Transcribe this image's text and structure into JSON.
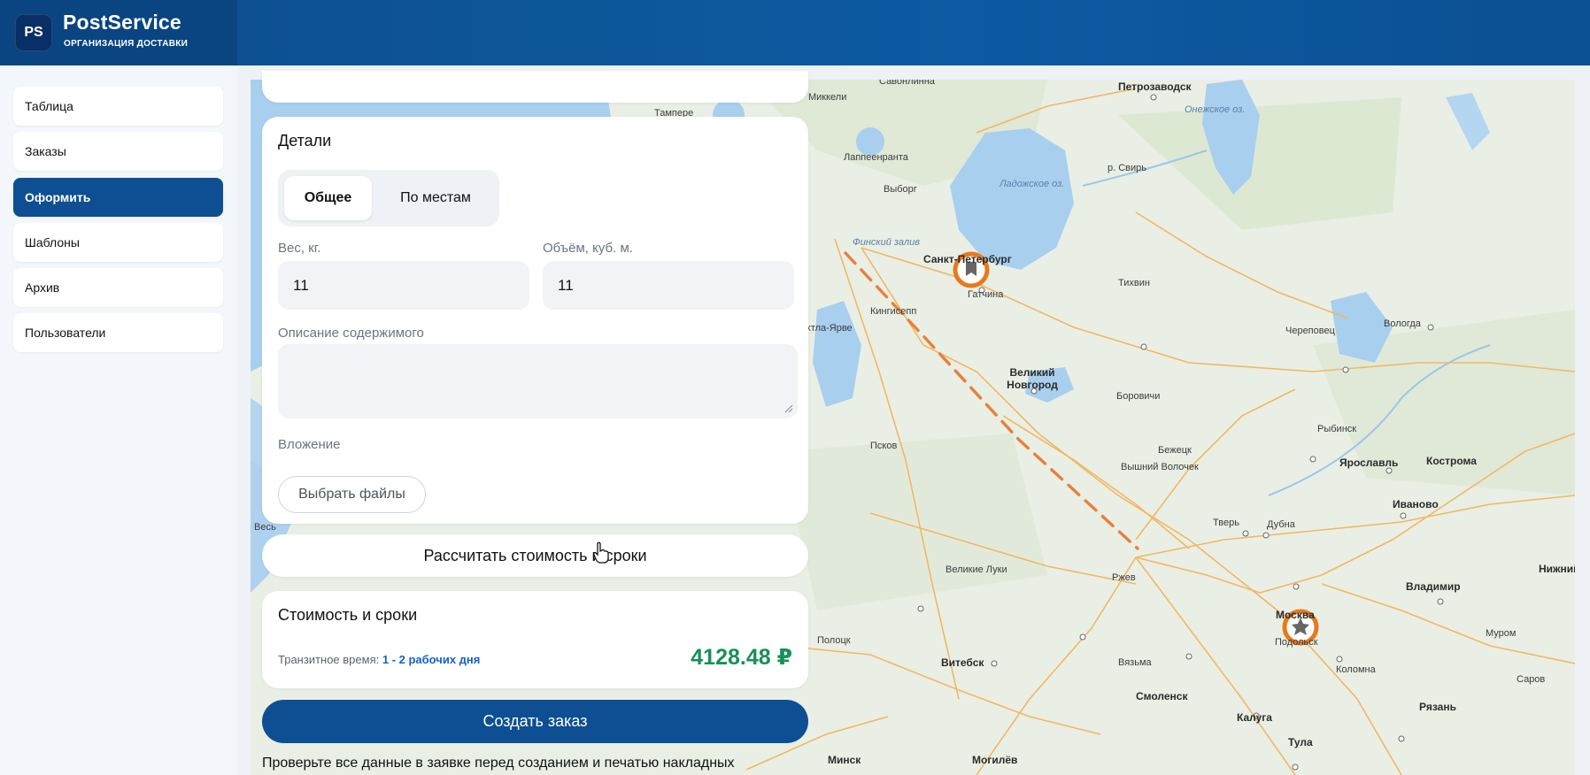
{
  "app": {
    "logo_badge": "PS",
    "name": "PostService",
    "subtitle": "ОРГАНИЗАЦИЯ ДОСТАВКИ"
  },
  "sidebar": {
    "items": [
      {
        "label": "Таблица",
        "active": false
      },
      {
        "label": "Заказы",
        "active": false
      },
      {
        "label": "Оформить",
        "active": true
      },
      {
        "label": "Шаблоны",
        "active": false
      },
      {
        "label": "Архив",
        "active": false
      },
      {
        "label": "Пользователи",
        "active": false
      }
    ]
  },
  "details": {
    "title": "Детали",
    "tabs": {
      "general": "Общее",
      "by_places": "По местам"
    },
    "weight": {
      "label": "Вес, кг.",
      "value": "11"
    },
    "volume": {
      "label": "Объём, куб. м.",
      "value": "11"
    },
    "description": {
      "label": "Описание содержимого",
      "value": ""
    },
    "attachment": {
      "label": "Вложение",
      "button": "Выбрать файлы"
    }
  },
  "actions": {
    "calculate": "Рассчитать стоимость и сроки",
    "create_order": "Создать заказ",
    "note": "Проверьте все данные в заявке перед созданием и печатью накладных"
  },
  "cost": {
    "title": "Стоимость и сроки",
    "transit_label": "Транзитное время:",
    "transit_value": "1 - 2 рабочих дня",
    "price": "4128.48 ₽"
  },
  "map": {
    "labels": {
      "petrozavodsk": "Петрозаводск",
      "onega": "Онежское оз.",
      "ladoga": "Ладожское оз.",
      "spb": "Санкт-Петербург",
      "gatchina": "Гатчина",
      "kingisepp": "Кингисепп",
      "vyborg": "Выборг",
      "gulf": "Финский залив",
      "svir": "р. Свирь",
      "tikhvin": "Тихвин",
      "cherepovets": "Череповец",
      "vologda": "Вологда",
      "novgorod": "Великий Новгород",
      "borovichi": "Боровичи",
      "rybinsk": "Рыбинск",
      "pskov": "Псков",
      "bezhetsk": "Бежецк",
      "yaroslavl": "Ярославль",
      "kostroma": "Кострома",
      "vyshny": "Вышний Волочек",
      "tver": "Тверь",
      "dubna": "Дубна",
      "ivanovo": "Иваново",
      "velikie_luki": "Великие Луки",
      "rzhev": "Ржев",
      "vladimir": "Владимир",
      "nizhny": "Нижний",
      "moscow": "Москва",
      "podolsk": "Подольск",
      "polotsk": "Полоцк",
      "vitebsk": "Витебск",
      "smolensk": "Смоленск",
      "vyazma": "Вязьма",
      "kolomna": "Коломна",
      "ryazan": "Рязань",
      "kaluga": "Калуга",
      "tula": "Тула",
      "minsk": "Минск",
      "mogilev": "Могилёв",
      "murom": "Муром",
      "sarov": "Саров",
      "mikkeli": "Миккели",
      "savonlinna": "Савонлинна",
      "lappeenranta": "Лаппеенранта",
      "tampere": "Тампере",
      "narva": "Кохтла-Ярве",
      "vesi": "Весь"
    }
  }
}
